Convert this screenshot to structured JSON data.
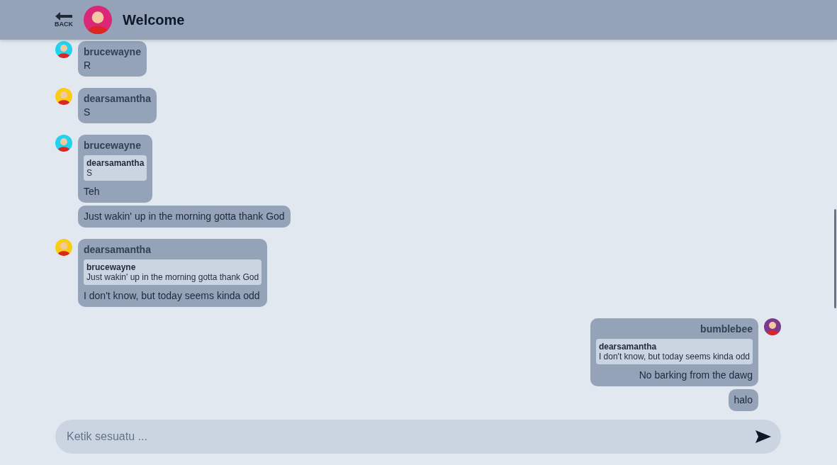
{
  "header": {
    "back_label": "BACK",
    "title": "Welcome"
  },
  "groups": [
    {
      "sender": "brucewayne",
      "mine": false,
      "color": "#22d3ee",
      "messages": [
        {
          "text": "R"
        }
      ]
    },
    {
      "sender": "dearsamantha",
      "mine": false,
      "color": "#facc15",
      "messages": [
        {
          "text": "S"
        }
      ]
    },
    {
      "sender": "brucewayne",
      "mine": false,
      "color": "#22d3ee",
      "messages": [
        {
          "reply": {
            "author": "dearsamantha",
            "text": "S"
          },
          "text": "Teh"
        },
        {
          "text": "Just wakin' up in the morning gotta thank God"
        }
      ]
    },
    {
      "sender": "dearsamantha",
      "mine": false,
      "color": "#facc15",
      "messages": [
        {
          "reply": {
            "author": "brucewayne",
            "text": "Just wakin' up in the morning gotta thank God"
          },
          "text": "I don't know, but today seems kinda odd"
        }
      ]
    },
    {
      "sender": "bumblebee",
      "mine": true,
      "color": "#7e3a8a",
      "messages": [
        {
          "reply": {
            "author": "dearsamantha",
            "text": "I don't know, but today seems kinda odd"
          },
          "text": "No barking from the dawg"
        },
        {
          "text": "halo"
        }
      ]
    }
  ],
  "composer": {
    "placeholder": "Ketik sesuatu ..."
  }
}
